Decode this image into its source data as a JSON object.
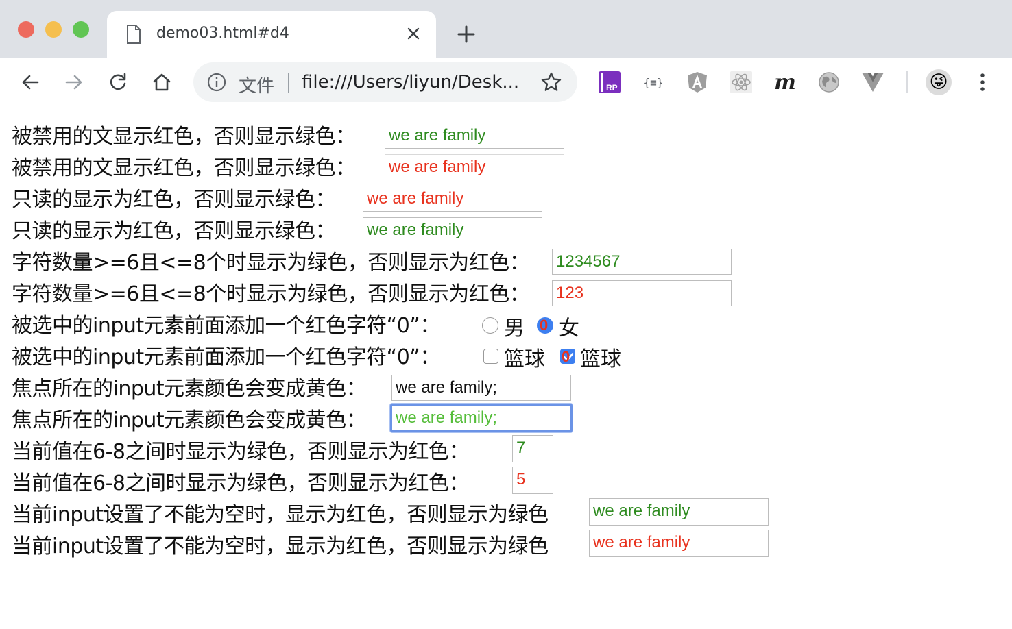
{
  "browser": {
    "tab_title": "demo03.html#d4",
    "omnibox_chip": "文件",
    "url": "file:///Users/liyun/Desk...",
    "extensions": [
      "axure-rp-icon",
      "json-formatter-icon",
      "angular-icon",
      "react-icon",
      "m-icon",
      "globe-icon",
      "vue-icon"
    ],
    "ext_text": {
      "json": "{≡}",
      "m": "m",
      "rp": "RP"
    },
    "profile_emoji": "😜"
  },
  "rows": [
    {
      "label": "被禁用的文显示红色，否则显示绿色：",
      "value": "we are family"
    },
    {
      "label": "被禁用的文显示红色，否则显示绿色：",
      "value": "we are family"
    },
    {
      "label": "只读的显示为红色，否则显示绿色：",
      "value": "we are family"
    },
    {
      "label": "只读的显示为红色，否则显示绿色：",
      "value": "we are family"
    },
    {
      "label": "字符数量>=6且<=8个时显示为绿色，否则显示为红色：",
      "value": "1234567"
    },
    {
      "label": "字符数量>=6且<=8个时显示为绿色，否则显示为红色：",
      "value": "123"
    },
    {
      "label": "被选中的input元素前面添加一个红色字符“0”：",
      "options": [
        "男",
        "女"
      ]
    },
    {
      "label": "被选中的input元素前面添加一个红色字符“0”：",
      "options": [
        "篮球",
        "篮球"
      ]
    },
    {
      "label": "焦点所在的input元素颜色会变成黄色：",
      "value": "we are family;"
    },
    {
      "label": "焦点所在的input元素颜色会变成黄色：",
      "value": "we are family;"
    },
    {
      "label": "当前值在6-8之间时显示为绿色，否则显示为红色：",
      "value": "7"
    },
    {
      "label": "当前值在6-8之间时显示为绿色，否则显示为红色：",
      "value": "5"
    },
    {
      "label": "当前input设置了不能为空时，显示为红色，否则显示为绿色",
      "value": "we are family"
    },
    {
      "label": "当前input设置了不能为空时，显示为红色，否则显示为绿色",
      "value": "we are family"
    }
  ],
  "checked_marker": "0",
  "colors": {
    "valid_green": "#2e8b1f",
    "invalid_red": "#e8321e",
    "focus_text": "#55bd3a",
    "focus_ring": "#6b93e6",
    "checked_blue": "#3d7ff0"
  }
}
